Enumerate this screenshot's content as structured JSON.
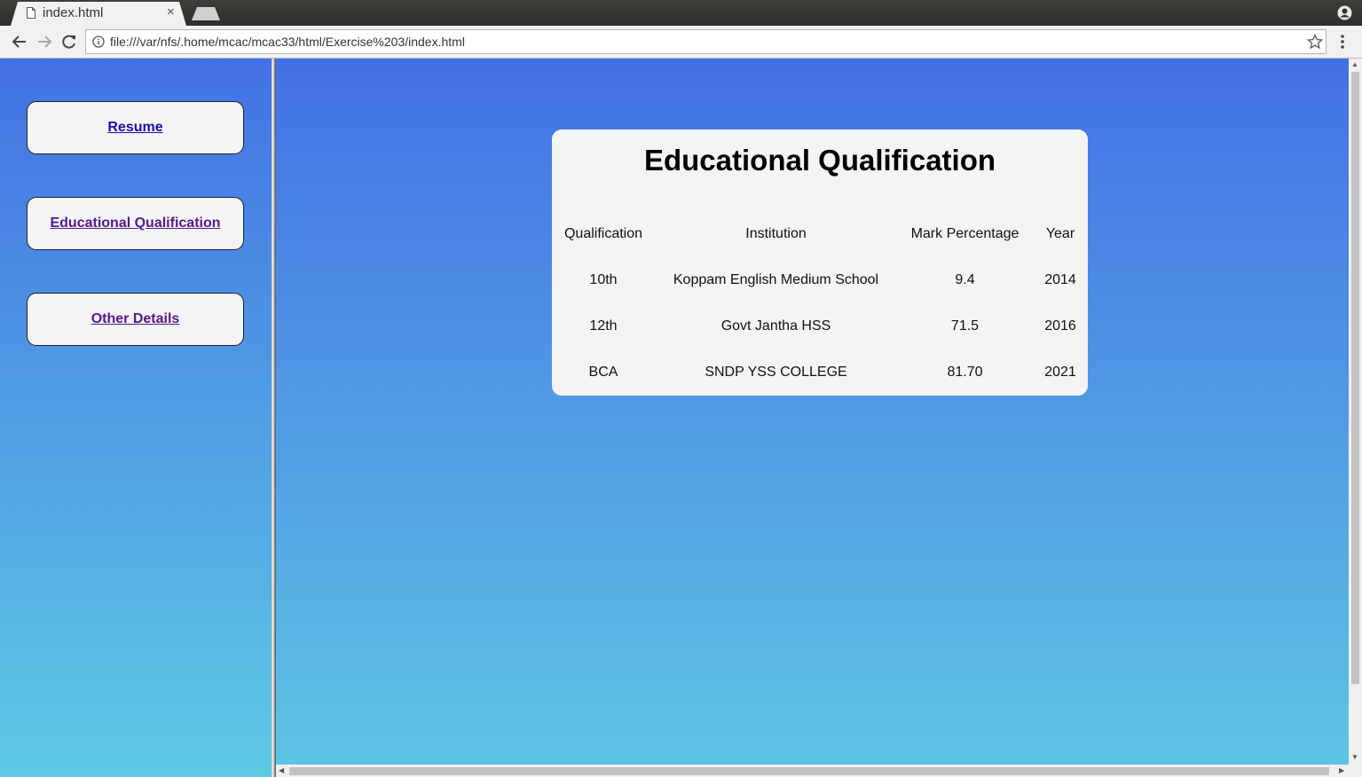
{
  "browser": {
    "tab_title": "index.html",
    "tab_close": "×",
    "url": "file:///var/nfs/.home/mcac/mcac33/html/Exercise%203/index.html"
  },
  "sidebar": {
    "links": [
      {
        "label": "Resume",
        "state": "unvisited"
      },
      {
        "label": "Educational Qualification",
        "state": "visited"
      },
      {
        "label": "Other Details",
        "state": "visited"
      }
    ]
  },
  "main": {
    "heading": "Educational Qualification",
    "table": {
      "headers": [
        "Qualification",
        "Institution",
        "Mark Percentage",
        "Year"
      ],
      "rows": [
        [
          "10th",
          "Koppam English Medium School",
          "9.4",
          "2014"
        ],
        [
          "12th",
          "Govt Jantha HSS",
          "71.5",
          "2016"
        ],
        [
          "BCA",
          "SNDP YSS COLLEGE",
          "81.70",
          "2021"
        ]
      ]
    }
  },
  "colors": {
    "gradient_top": "#4370e5",
    "gradient_bottom": "#5ec6e4",
    "card_bg": "#f4f4f4",
    "unvisited_link": "#1a0dab",
    "visited_link": "#551a8b"
  },
  "icons": {
    "tab": "page-icon",
    "back": "back-arrow-icon",
    "forward": "forward-arrow-icon",
    "reload": "reload-icon",
    "info": "info-icon",
    "bookmark": "star-icon",
    "menu": "kebab-menu-icon",
    "profile": "profile-icon"
  }
}
